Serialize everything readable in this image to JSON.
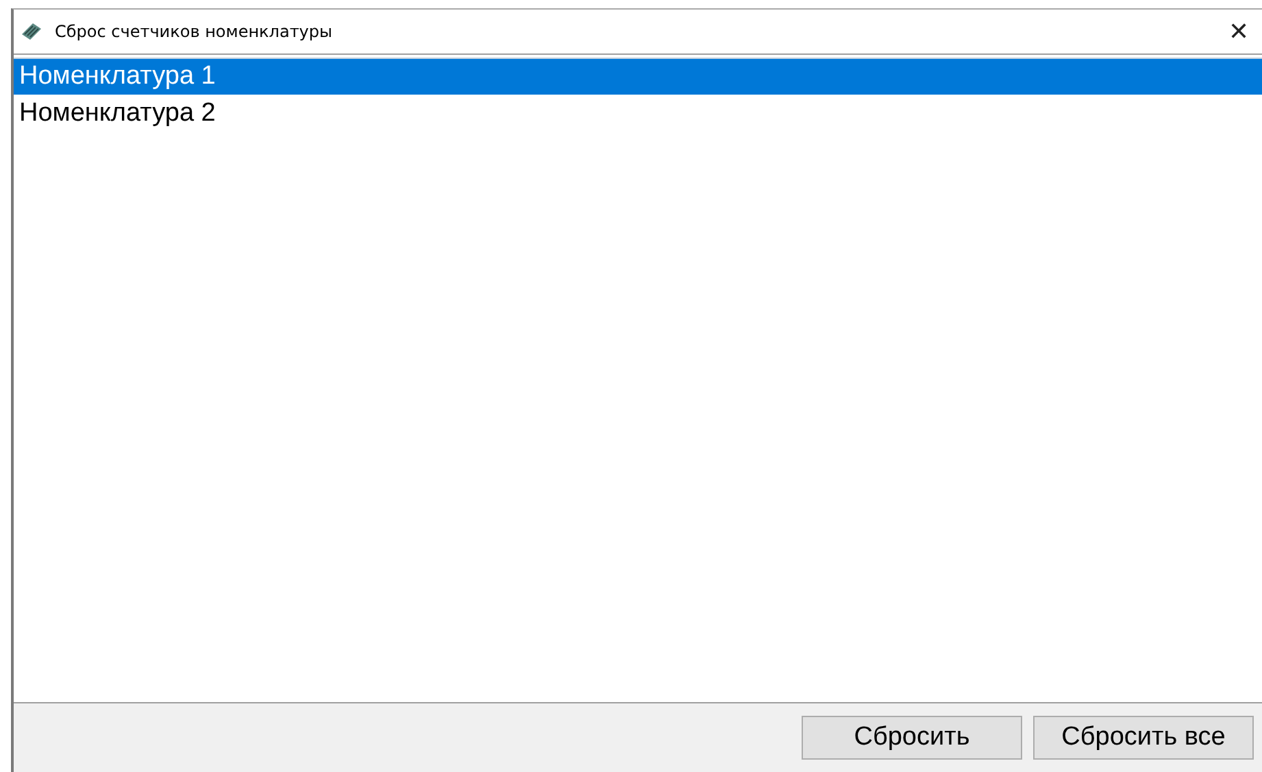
{
  "window": {
    "title": "Сброс счетчиков номенклатуры",
    "close": "✕"
  },
  "list": {
    "items": [
      {
        "label": "Номенклатура 1",
        "selected": true
      },
      {
        "label": "Номенклатура 2",
        "selected": false
      }
    ]
  },
  "buttons": [
    {
      "label": "Сбросить"
    },
    {
      "label": "Сбросить все"
    }
  ]
}
